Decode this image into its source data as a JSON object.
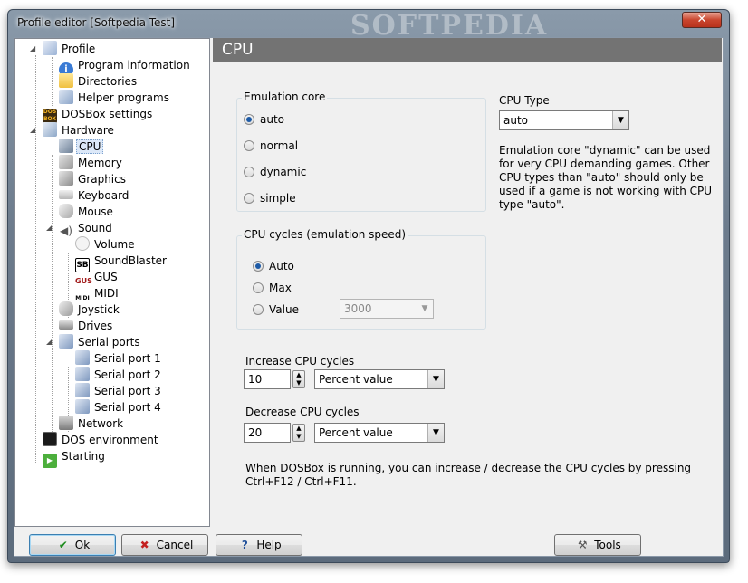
{
  "window": {
    "title": "Profile editor [Softpedia Test]",
    "watermark": "SOFTPEDIA",
    "close_label": "✕"
  },
  "tree": {
    "items": [
      {
        "label": "Profile",
        "icon": "profile-icon"
      },
      {
        "label": "Program information",
        "icon": "info-icon"
      },
      {
        "label": "Directories",
        "icon": "folder-icon"
      },
      {
        "label": "Helper programs",
        "icon": "helper-icon"
      },
      {
        "label": "DOSBox settings",
        "icon": "dosbox-icon"
      },
      {
        "label": "Hardware",
        "icon": "hardware-icon"
      },
      {
        "label": "CPU",
        "icon": "cpu-icon"
      },
      {
        "label": "Memory",
        "icon": "memory-icon"
      },
      {
        "label": "Graphics",
        "icon": "graphics-icon"
      },
      {
        "label": "Keyboard",
        "icon": "keyboard-icon"
      },
      {
        "label": "Mouse",
        "icon": "mouse-icon"
      },
      {
        "label": "Sound",
        "icon": "sound-icon"
      },
      {
        "label": "Volume",
        "icon": "volume-icon"
      },
      {
        "label": "SoundBlaster",
        "icon": "soundblaster-icon",
        "icon_text": "SB"
      },
      {
        "label": "GUS",
        "icon": "gus-icon",
        "icon_text": "GUS"
      },
      {
        "label": "MIDI",
        "icon": "midi-icon",
        "icon_text": "MIDI"
      },
      {
        "label": "Joystick",
        "icon": "joystick-icon"
      },
      {
        "label": "Drives",
        "icon": "drives-icon"
      },
      {
        "label": "Serial ports",
        "icon": "serial-icon"
      },
      {
        "label": "Serial port 1",
        "icon": "serial-port-icon"
      },
      {
        "label": "Serial port 2",
        "icon": "serial-port-icon"
      },
      {
        "label": "Serial port 3",
        "icon": "serial-port-icon"
      },
      {
        "label": "Serial port 4",
        "icon": "serial-port-icon"
      },
      {
        "label": "Network",
        "icon": "network-icon"
      },
      {
        "label": "DOS environment",
        "icon": "dos-environment-icon"
      },
      {
        "label": "Starting",
        "icon": "starting-icon"
      }
    ],
    "selected": "CPU"
  },
  "panel": {
    "title": "CPU",
    "emulation_core": {
      "title": "Emulation core",
      "options": [
        "auto",
        "normal",
        "dynamic",
        "simple"
      ],
      "selected": "auto"
    },
    "cpu_cycles": {
      "title": "CPU cycles (emulation speed)",
      "options": [
        "Auto",
        "Max",
        "Value"
      ],
      "selected": "Auto",
      "value_placeholder": "3000"
    },
    "cpu_type": {
      "label": "CPU Type",
      "value": "auto",
      "help": "Emulation core \"dynamic\" can be used for very CPU demanding games. Other CPU types than \"auto\" should only be used if a game is not working with CPU type \"auto\"."
    },
    "increase": {
      "label": "Increase CPU cycles",
      "value": "10",
      "mode": "Percent value"
    },
    "decrease": {
      "label": "Decrease CPU cycles",
      "value": "20",
      "mode": "Percent value"
    },
    "footer_note": "When DOSBox is running, you can increase / decrease the CPU cycles by pressing Ctrl+F12 / Ctrl+F11."
  },
  "buttons": {
    "ok": "Ok",
    "cancel": "Cancel",
    "help": "Help",
    "tools": "Tools"
  },
  "colors": {
    "panel_header": "#737373",
    "selection": "#dce8f8",
    "ok_check": "#1e8c1e",
    "cancel_x": "#c42020",
    "help_icon": "#1f4f99"
  }
}
